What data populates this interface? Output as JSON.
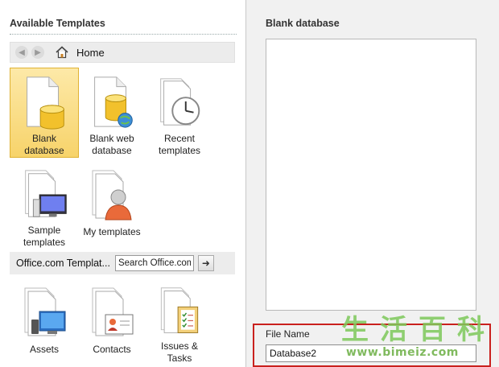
{
  "left_pane": {
    "title": "Available Templates",
    "nav": {
      "back_icon": "back-arrow-icon",
      "forward_icon": "forward-arrow-icon",
      "home_icon": "home-icon",
      "home_label": "Home"
    },
    "templates": [
      {
        "id": "blank-database",
        "label": "Blank database",
        "label_lines": [
          "Blank",
          "database"
        ],
        "icon": "blank-database-icon",
        "selected": true
      },
      {
        "id": "blank-web-database",
        "label": "Blank web database",
        "label_lines": [
          "Blank web",
          "database"
        ],
        "icon": "web-database-icon",
        "selected": false
      },
      {
        "id": "recent-templates",
        "label": "Recent templates",
        "label_lines": [
          "Recent",
          "templates"
        ],
        "icon": "clock-document-icon",
        "selected": false
      },
      {
        "id": "sample-templates",
        "label": "Sample templates",
        "label_lines": [
          "Sample",
          "templates"
        ],
        "icon": "computer-document-icon",
        "selected": false
      },
      {
        "id": "my-templates",
        "label": "My templates",
        "label_lines": [
          "My templates"
        ],
        "icon": "person-document-icon",
        "selected": false
      }
    ],
    "office_bar": {
      "label": "Office.com Templat...",
      "search_value": "Search Office.com",
      "go_icon": "arrow-right-icon"
    },
    "office_templates": [
      {
        "id": "assets",
        "label_lines": [
          "Assets"
        ],
        "icon": "assets-icon"
      },
      {
        "id": "contacts",
        "label_lines": [
          "Contacts"
        ],
        "icon": "contacts-card-icon"
      },
      {
        "id": "issues-tasks",
        "label_lines": [
          "Issues &",
          "Tasks"
        ],
        "icon": "checklist-clipboard-icon"
      }
    ]
  },
  "right_pane": {
    "title": "Blank database",
    "file_name_label": "File Name",
    "file_name_value": "Database2"
  },
  "watermark": {
    "glyphs": [
      "生",
      "活",
      "百",
      "科"
    ],
    "url": "www.bimeiz.com"
  },
  "colors": {
    "selected_tile_top": "#fde9a8",
    "selected_tile_bottom": "#f7d36a",
    "highlight_frame": "#c9211e",
    "watermark_green": "#7dc85a"
  }
}
